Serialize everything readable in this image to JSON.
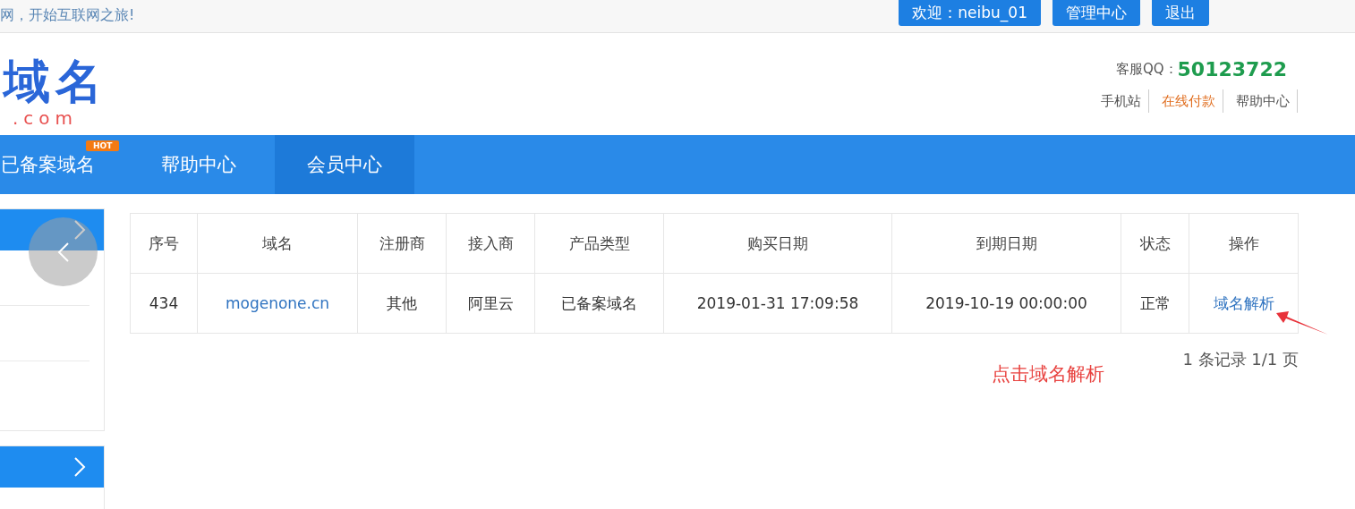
{
  "top_bar": {
    "welcome_text": "网，开始互联网之旅!",
    "buttons": [
      {
        "label": "欢迎：neibu_01"
      },
      {
        "label": "管理中心"
      },
      {
        "label": "退出"
      }
    ]
  },
  "header": {
    "logo": {
      "mark": "域名",
      "domain": ".com"
    },
    "qq_label": "客服QQ：",
    "qq_number": "50123722",
    "links": [
      {
        "label": "手机站",
        "kind": "normal"
      },
      {
        "label": "在线付款",
        "kind": "highlight"
      },
      {
        "label": "帮助中心",
        "kind": "normal"
      }
    ]
  },
  "nav": [
    {
      "label": "已备案域名",
      "badge": "HOT",
      "selected": false
    },
    {
      "label": "帮助中心",
      "selected": false
    },
    {
      "label": "会员中心",
      "selected": true
    }
  ],
  "table": {
    "columns": [
      "序号",
      "域名",
      "注册商",
      "接入商",
      "产品类型",
      "购买日期",
      "到期日期",
      "状态",
      "操作"
    ],
    "rows": [
      {
        "cells": [
          {
            "text": "434",
            "kind": "text"
          },
          {
            "text": "mogenone.cn",
            "kind": "link"
          },
          {
            "text": "其他",
            "kind": "text"
          },
          {
            "text": "阿里云",
            "kind": "text"
          },
          {
            "text": "已备案域名",
            "kind": "text"
          },
          {
            "text": "2019-01-31 17:09:58",
            "kind": "text"
          },
          {
            "text": "2019-10-19 00:00:00",
            "kind": "text"
          },
          {
            "text": "正常",
            "kind": "text"
          },
          {
            "text": "域名解析",
            "kind": "link"
          }
        ]
      }
    ]
  },
  "pagination": "1 条记录 1/1 页",
  "annotation": {
    "text": "点击域名解析"
  }
}
